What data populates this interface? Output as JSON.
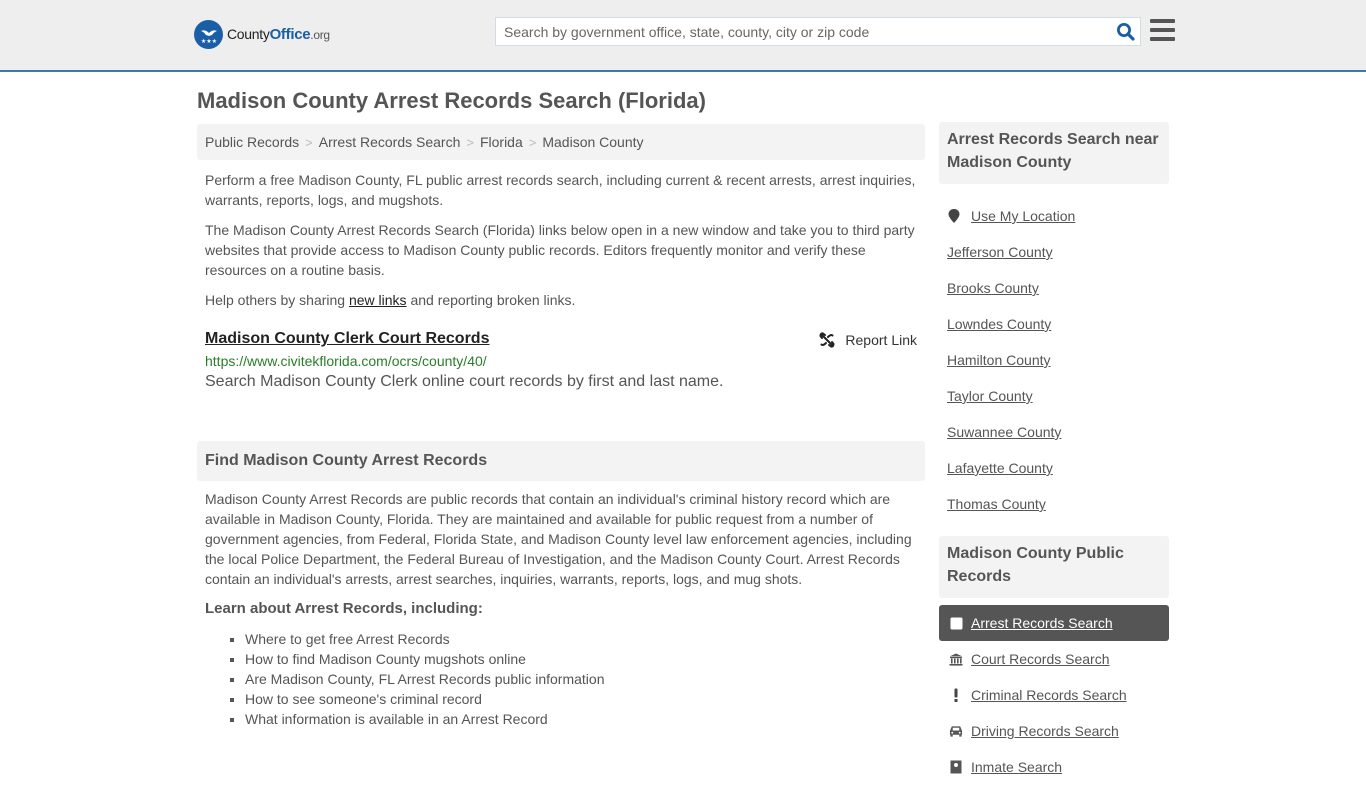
{
  "header": {
    "logo": {
      "part1": "County",
      "part2": "Office",
      "part3": ".org"
    },
    "search_placeholder": "Search by government office, state, county, city or zip code",
    "search_value": "",
    "brand_color": "#1a5fa5",
    "accent_bar_color": "#3a7aaa"
  },
  "page_title": "Madison County Arrest Records Search (Florida)",
  "breadcrumb": [
    {
      "label": "Public Records"
    },
    {
      "label": "Arrest Records Search"
    },
    {
      "label": "Florida"
    },
    {
      "label": "Madison County"
    }
  ],
  "breadcrumb_separator": ">",
  "intro": {
    "p1": "Perform a free Madison County, FL public arrest records search, including current & recent arrests, arrest inquiries, warrants, reports, logs, and mugshots.",
    "p2": "The Madison County Arrest Records Search (Florida) links below open in a new window and take you to third party websites that provide access to Madison County public records. Editors frequently monitor and verify these resources on a routine basis.",
    "p3_before": "Help others by sharing ",
    "p3_link": "new links",
    "p3_after": " and reporting broken links."
  },
  "listing": {
    "title": "Madison County Clerk Court Records",
    "url": "https://www.civitekflorida.com/ocrs/county/40/",
    "description": "Search Madison County Clerk online court records by first and last name.",
    "report_label": "Report Link"
  },
  "find_section": {
    "heading": "Find Madison County Arrest Records",
    "body": "Madison County Arrest Records are public records that contain an individual's criminal history record which are available in Madison County, Florida. They are maintained and available for public request from a number of government agencies, from Federal, Florida State, and Madison County level law enforcement agencies, including the local Police Department, the Federal Bureau of Investigation, and the Madison County Court. Arrest Records contain an individual's arrests, arrest searches, inquiries, warrants, reports, logs, and mug shots.",
    "learn_heading": "Learn about Arrest Records, including:",
    "learn_items": [
      "Where to get free Arrest Records",
      "How to find Madison County mugshots online",
      "Are Madison County, FL Arrest Records public information",
      "How to see someone's criminal record",
      "What information is available in an Arrest Record"
    ]
  },
  "sidebar": {
    "near_heading": "Arrest Records Search near Madison County",
    "use_location": "Use My Location",
    "near_items": [
      "Jefferson County",
      "Brooks County",
      "Lowndes County",
      "Hamilton County",
      "Taylor County",
      "Suwannee County",
      "Lafayette County",
      "Thomas County"
    ],
    "public_heading": "Madison County Public Records",
    "public_items": [
      {
        "label": "Arrest Records Search",
        "icon": "square-icon",
        "active": true
      },
      {
        "label": "Court Records Search",
        "icon": "courthouse-icon",
        "active": false
      },
      {
        "label": "Criminal Records Search",
        "icon": "exclamation-icon",
        "active": false
      },
      {
        "label": "Driving Records Search",
        "icon": "car-icon",
        "active": false
      },
      {
        "label": "Inmate Search",
        "icon": "inmate-icon",
        "active": false
      }
    ]
  }
}
